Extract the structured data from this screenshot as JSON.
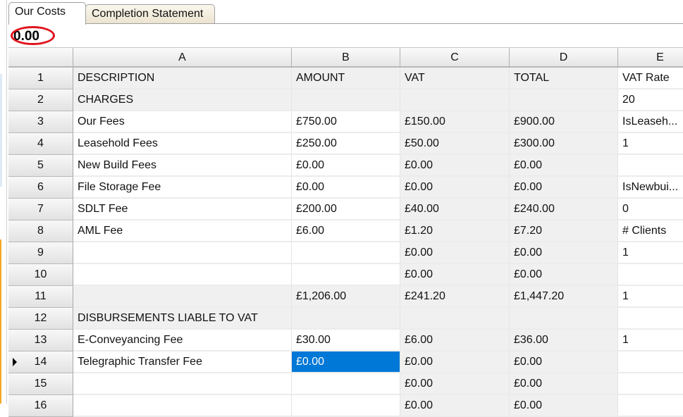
{
  "tabs": [
    {
      "label": "Our Costs",
      "active": true
    },
    {
      "label": "Completion Statement",
      "active": false
    }
  ],
  "formula_bar": {
    "value": "0.00"
  },
  "columns": [
    "A",
    "B",
    "C",
    "D",
    "E"
  ],
  "rows": [
    {
      "num": "1",
      "cells": [
        "DESCRIPTION",
        "AMOUNT",
        "VAT",
        "TOTAL",
        "VAT Rate"
      ],
      "bg": [
        "g",
        "g",
        "g",
        "g",
        "w"
      ]
    },
    {
      "num": "2",
      "cells": [
        "CHARGES",
        "",
        "",
        "",
        "20"
      ],
      "bg": [
        "g",
        "g",
        "g",
        "g",
        "w"
      ]
    },
    {
      "num": "3",
      "cells": [
        "Our Fees",
        "£750.00",
        "£150.00",
        "£900.00",
        "IsLeaseh..."
      ],
      "bg": [
        "w",
        "w",
        "g",
        "g",
        "w"
      ]
    },
    {
      "num": "4",
      "cells": [
        "Leasehold Fees",
        "£250.00",
        "£50.00",
        "£300.00",
        "1"
      ],
      "bg": [
        "w",
        "w",
        "g",
        "g",
        "w"
      ]
    },
    {
      "num": "5",
      "cells": [
        "New Build Fees",
        "£0.00",
        "£0.00",
        "£0.00",
        ""
      ],
      "bg": [
        "w",
        "w",
        "g",
        "g",
        "w"
      ]
    },
    {
      "num": "6",
      "cells": [
        "File Storage Fee",
        "£0.00",
        "£0.00",
        "£0.00",
        "IsNewbui..."
      ],
      "bg": [
        "w",
        "w",
        "g",
        "g",
        "w"
      ]
    },
    {
      "num": "7",
      "cells": [
        "SDLT Fee",
        "£200.00",
        "£40.00",
        "£240.00",
        "0"
      ],
      "bg": [
        "w",
        "w",
        "g",
        "g",
        "w"
      ]
    },
    {
      "num": "8",
      "cells": [
        "AML Fee",
        "£6.00",
        "£1.20",
        "£7.20",
        "# Clients"
      ],
      "bg": [
        "w",
        "w",
        "g",
        "g",
        "w"
      ]
    },
    {
      "num": "9",
      "cells": [
        "",
        "",
        "£0.00",
        "£0.00",
        "1"
      ],
      "bg": [
        "w",
        "w",
        "g",
        "g",
        "w"
      ]
    },
    {
      "num": "10",
      "cells": [
        "",
        "",
        "£0.00",
        "£0.00",
        ""
      ],
      "bg": [
        "w",
        "w",
        "g",
        "g",
        "w"
      ]
    },
    {
      "num": "11",
      "cells": [
        "",
        "£1,206.00",
        "£241.20",
        "£1,447.20",
        "1"
      ],
      "bg": [
        "g",
        "g",
        "g",
        "g",
        "w"
      ]
    },
    {
      "num": "12",
      "cells": [
        "DISBURSEMENTS LIABLE TO VAT",
        "",
        "",
        "",
        ""
      ],
      "bg": [
        "g",
        "g",
        "g",
        "g",
        "w"
      ]
    },
    {
      "num": "13",
      "cells": [
        "E-Conveyancing Fee",
        "£30.00",
        "£6.00",
        "£36.00",
        "1"
      ],
      "bg": [
        "w",
        "w",
        "g",
        "g",
        "w"
      ]
    },
    {
      "num": "14",
      "cells": [
        "Telegraphic Transfer Fee",
        "£0.00",
        "£0.00",
        "£0.00",
        ""
      ],
      "bg": [
        "w",
        "sel",
        "g",
        "g",
        "w"
      ],
      "current": true
    },
    {
      "num": "15",
      "cells": [
        "",
        "",
        "£0.00",
        "£0.00",
        ""
      ],
      "bg": [
        "w",
        "w",
        "g",
        "g",
        "w"
      ]
    },
    {
      "num": "16",
      "cells": [
        "",
        "",
        "£0.00",
        "£0.00",
        ""
      ],
      "bg": [
        "w",
        "w",
        "g",
        "g",
        "w"
      ]
    }
  ]
}
